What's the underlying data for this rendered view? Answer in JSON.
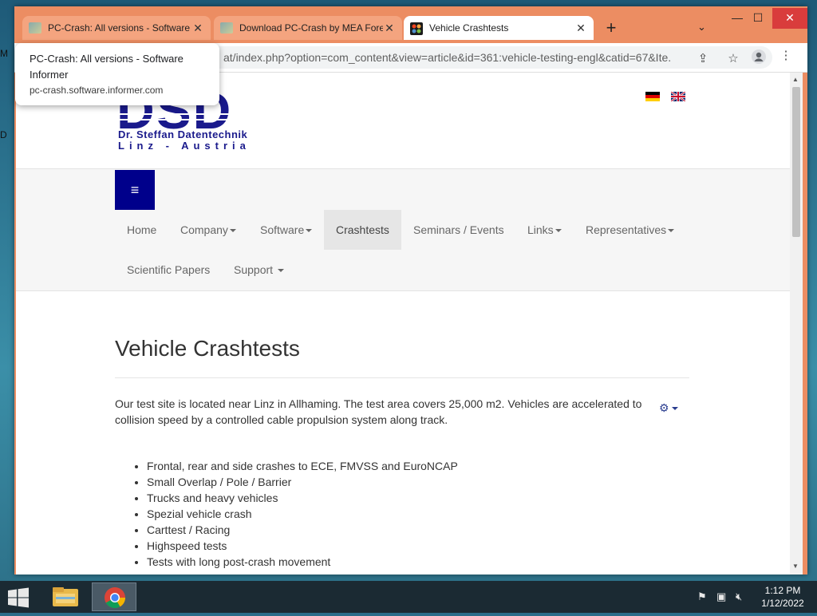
{
  "desktop": {
    "edge_letters": [
      "M",
      "D"
    ]
  },
  "browser": {
    "tabs": [
      {
        "title": "PC-Crash: All versions - Software Informer",
        "state": "inactive"
      },
      {
        "title": "Download PC-Crash by MEA Forensic",
        "state": "inactive"
      },
      {
        "title": "Vehicle Crashtests",
        "state": "active"
      }
    ],
    "new_tab_label": "+",
    "tab_list_label": "⌄",
    "window_controls": {
      "minimize": "—",
      "maximize": "☐",
      "close": "✕"
    },
    "url": "at/index.php?option=com_content&view=article&id=361:vehicle-testing-engl&catid=67&Ite...",
    "tooltip": {
      "title": "PC-Crash: All versions - Software Informer",
      "url": "pc-crash.software.informer.com"
    }
  },
  "site": {
    "logo": {
      "letters": "DSD",
      "line1": "Dr. Steffan Datentechnik",
      "line2": "Linz - Austria"
    },
    "languages": [
      "de-flag",
      "en-flag"
    ],
    "menu_toggle": "≡",
    "nav": [
      {
        "label": "Home",
        "dropdown": false
      },
      {
        "label": "Company",
        "dropdown": true
      },
      {
        "label": "Software",
        "dropdown": true
      },
      {
        "label": "Crashtests",
        "dropdown": false,
        "active": true
      },
      {
        "label": "Seminars / Events",
        "dropdown": false
      },
      {
        "label": "Links",
        "dropdown": true
      },
      {
        "label": "Representatives",
        "dropdown": true
      },
      {
        "label": "Scientific Papers",
        "dropdown": false
      },
      {
        "label": "Support",
        "dropdown": true
      }
    ],
    "article": {
      "title": "Vehicle Crashtests",
      "intro": "Our test site is located near Linz in Allhaming. The test area covers 25,000 m2. Vehicles are accelerated to collision speed by a controlled cable propulsion system along track.",
      "bullets": [
        "Frontal, rear and side crashes to ECE, FMVSS and EuroNCAP",
        "Small Overlap / Pole / Barrier",
        "Trucks and heavy vehicles",
        "Spezial vehicle crash",
        "Carttest / Racing",
        "Highspeed tests",
        "Tests with long post-crash movement"
      ]
    }
  },
  "taskbar": {
    "clock_time": "1:12 PM",
    "clock_date": "1/12/2022"
  },
  "colors": {
    "nav_toggle_bg": "#00008b",
    "logo_blue": "#1a1a8c",
    "window_frame": "#ec8d62"
  }
}
